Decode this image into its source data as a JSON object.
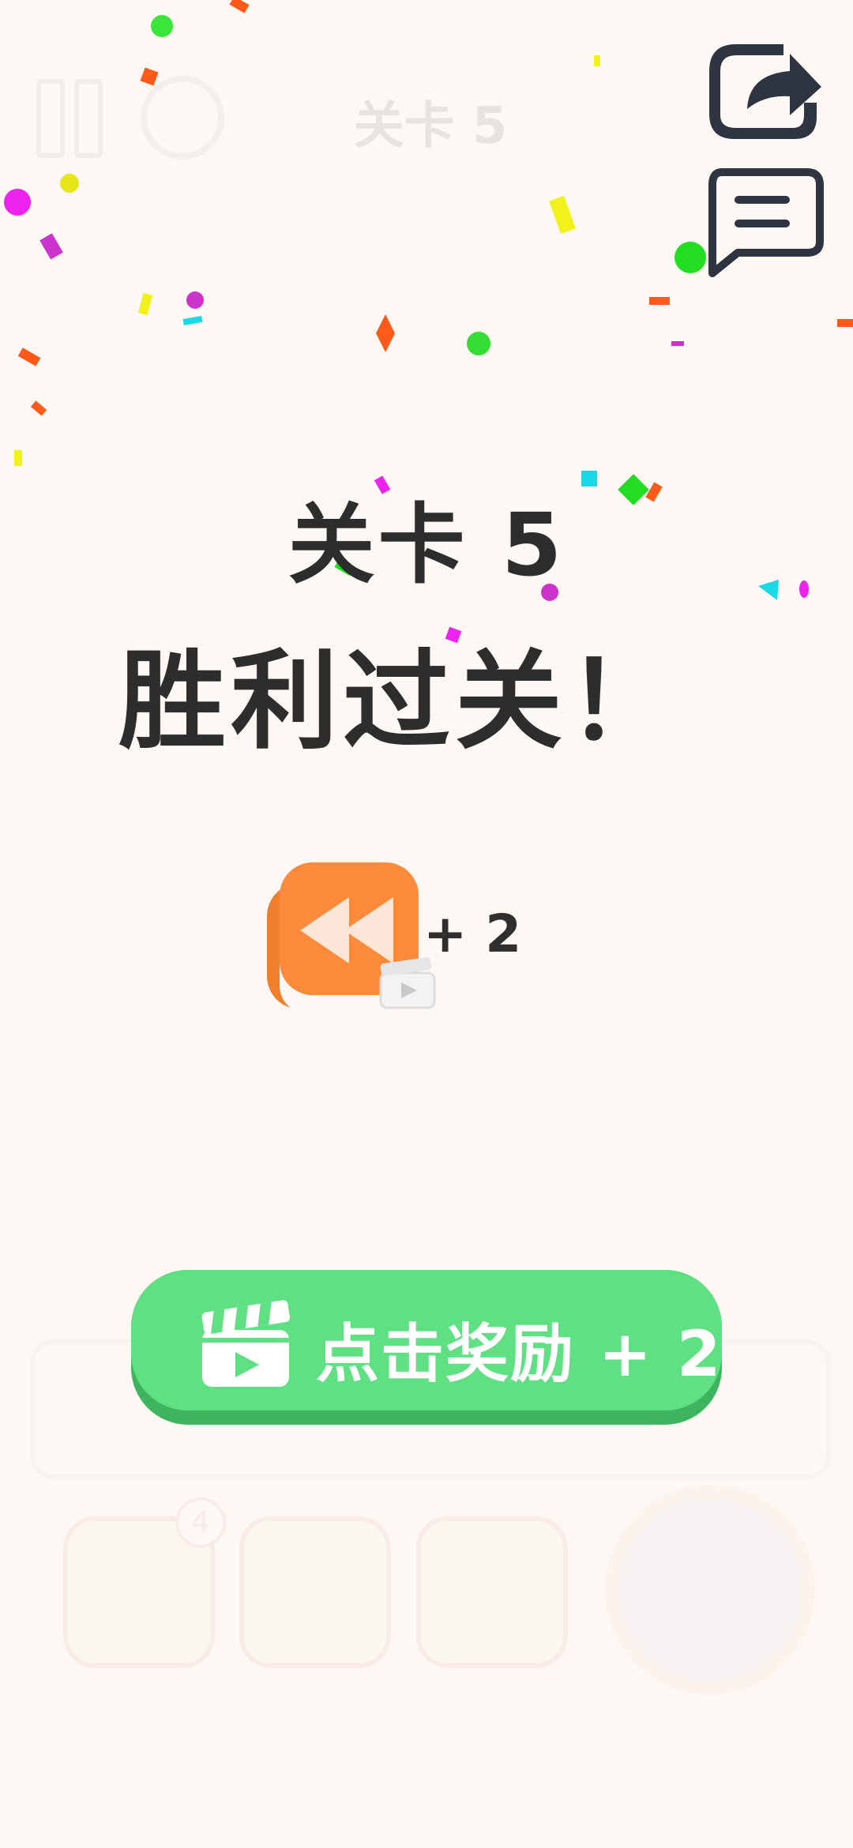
{
  "top_bar": {
    "title": "关卡 5"
  },
  "result": {
    "level_label": "关卡 5",
    "win_message": "胜利过关！"
  },
  "reward": {
    "amount_label": "+ 2"
  },
  "ad_button": {
    "label": "点击奖励 + 2"
  },
  "tools": {
    "undo_badge": "4"
  },
  "colors": {
    "accent_green": "#5fe083",
    "accent_green_dark": "#3fb45e",
    "reward_orange": "#fb8a3a",
    "text_dark": "#2d2d2d",
    "icon_navy": "#2e3540"
  },
  "icons": {
    "share": "share-icon",
    "message": "message-icon",
    "rewind": "rewind-icon",
    "video": "video-clapper-icon"
  }
}
